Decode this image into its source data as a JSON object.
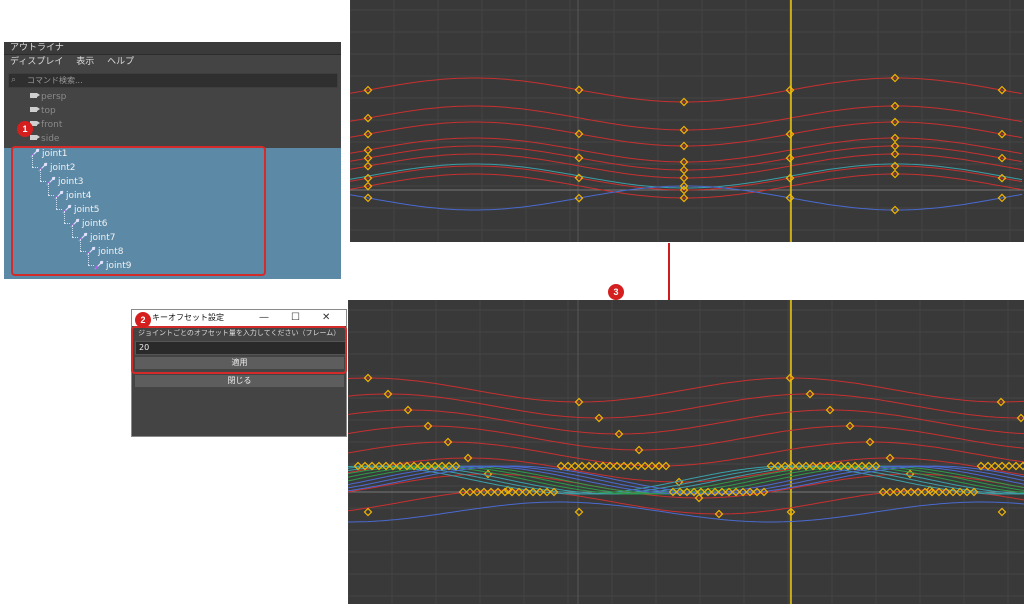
{
  "outliner": {
    "title": "アウトライナ",
    "menu": [
      "ディスプレイ",
      "表示",
      "ヘルプ"
    ],
    "search_placeholder": "コマンド検索...",
    "cameras": [
      "persp",
      "top",
      "front",
      "side"
    ],
    "joints": [
      "joint1",
      "joint2",
      "joint3",
      "joint4",
      "joint5",
      "joint6",
      "joint7",
      "joint8",
      "joint9"
    ]
  },
  "dialog": {
    "title": "キーオフセット設定",
    "instruction": "ジョイントごとのオフセット量を入力してください（フレーム）",
    "value": "20",
    "apply_label": "適用",
    "close_label": "閉じる"
  },
  "badges": [
    "1",
    "2",
    "3"
  ],
  "colors": {
    "selection": "#5c89a6",
    "badge": "#d51f1f",
    "key": "#f0b400",
    "red_curve": "#c83030",
    "timeline_marker": "#f0c800"
  }
}
